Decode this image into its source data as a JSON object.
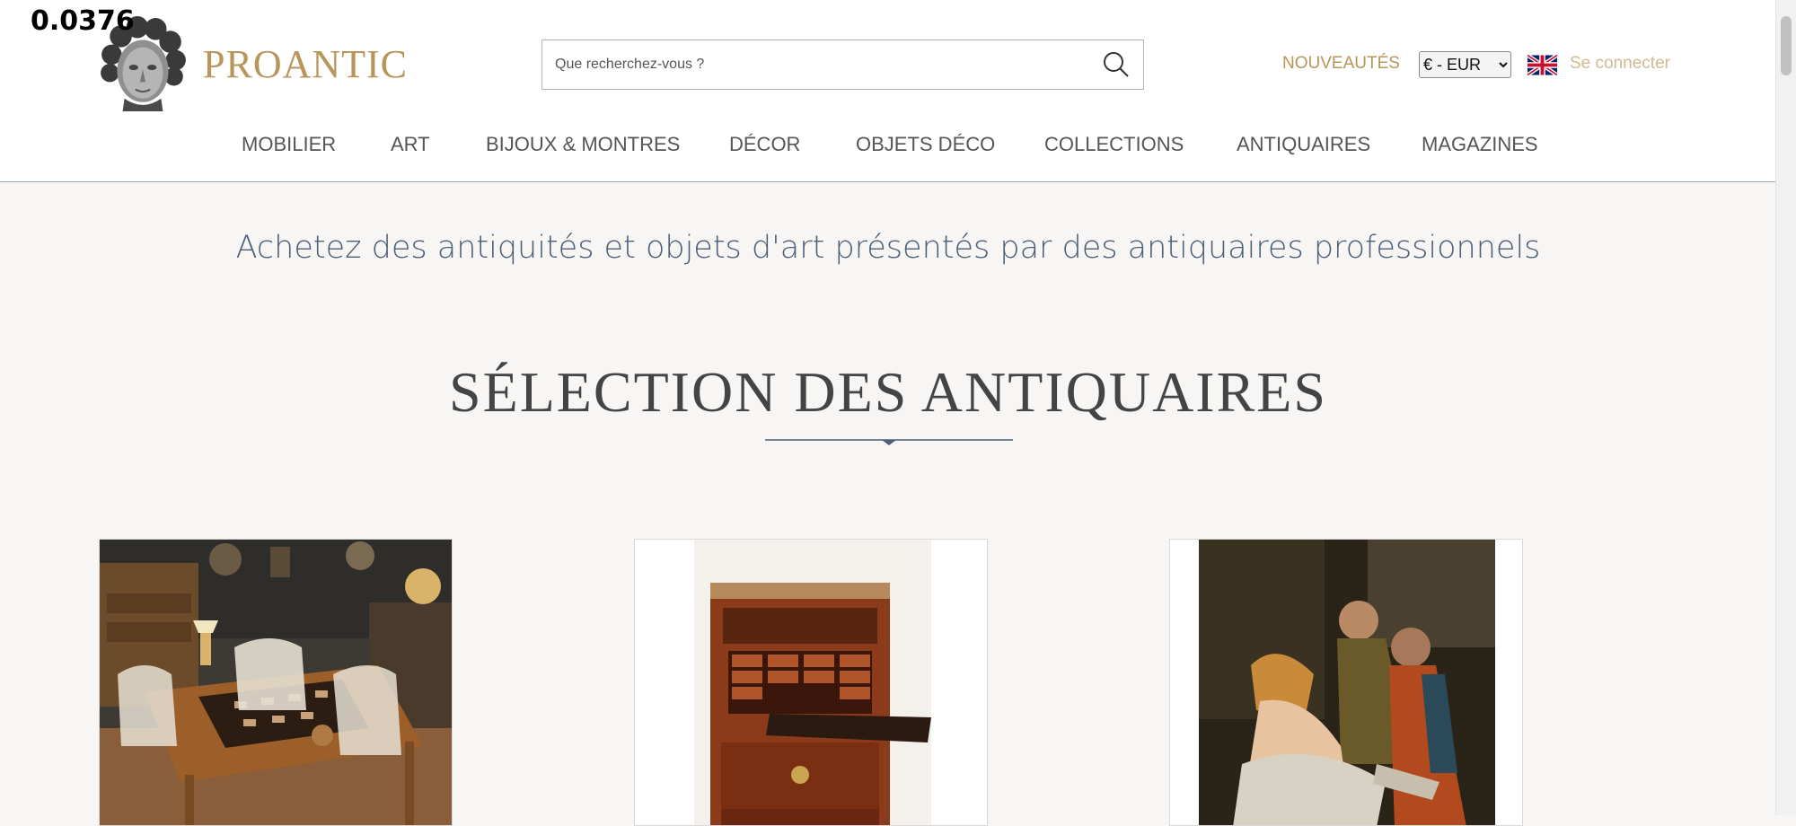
{
  "overlay": {
    "value": "0.0376"
  },
  "brand": {
    "name": "PROANTIC"
  },
  "search": {
    "placeholder": "Que recherchez-vous ?"
  },
  "header": {
    "new_label": "NOUVEAUTÉS",
    "currency": "€ - EUR",
    "login_label": "Se connecter"
  },
  "nav": {
    "items": [
      {
        "label": "MOBILIER"
      },
      {
        "label": "ART"
      },
      {
        "label": "BIJOUX & MONTRES"
      },
      {
        "label": "DÉCOR"
      },
      {
        "label": "OBJETS DÉCO"
      },
      {
        "label": "COLLECTIONS"
      },
      {
        "label": "ANTIQUAIRES"
      },
      {
        "label": "MAGAZINES"
      }
    ]
  },
  "main": {
    "tagline": "Achetez des antiquités et objets d'art présentés par des antiquaires professionnels",
    "section_title": "SÉLECTION DES ANTIQUAIRES"
  },
  "colors": {
    "brand_gold": "#b8955a",
    "tagline_blue": "#4c5f76",
    "background": "#f7f6f4"
  },
  "icons": [
    "search-icon",
    "uk-flag-icon",
    "logo-head-icon",
    "divider-diamond-icon"
  ]
}
